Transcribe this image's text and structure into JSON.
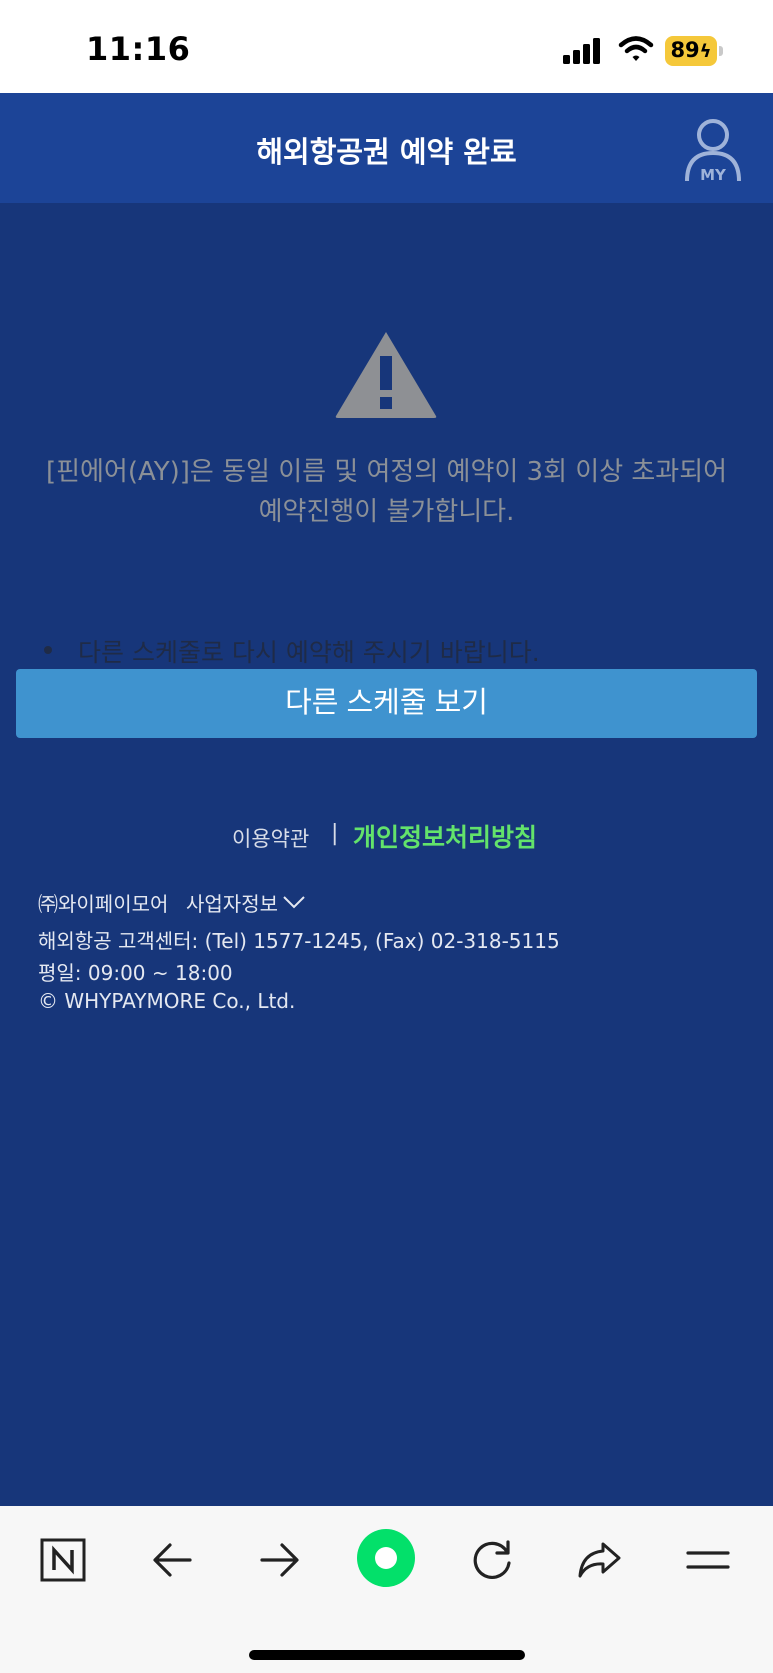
{
  "status_bar": {
    "time": "11:16",
    "battery": "89",
    "battery_color": "#f5c83a"
  },
  "header": {
    "title": "해외항공권 예약 완료",
    "my_label": "MY"
  },
  "message": {
    "text": "[핀에어(AY)]은 동일 이름 및 여정의 예약이 3회 이상 초과되어 예약진행이 불가합니다.",
    "hint": "다른 스케줄로 다시 예약해 주시기 바랍니다."
  },
  "actions": {
    "schedule_button": "다른 스케줄 보기"
  },
  "footer": {
    "terms": "이용약관",
    "divider": "|",
    "privacy": "개인정보처리방침",
    "company": "㈜와이페이모어",
    "biz_info": "사업자정보",
    "contact": "해외항공 고객센터: (Tel) 1577-1245, (Fax) 02-318-5115",
    "hours": "평일: 09:00 ~ 18:00",
    "copyright": "© WHYPAYMORE Co., Ltd."
  },
  "toolbar": {
    "items": [
      "naver-home-icon",
      "back-arrow-icon",
      "forward-arrow-icon",
      "green-dot-icon",
      "refresh-icon",
      "share-icon",
      "menu-icon"
    ]
  },
  "colors": {
    "header_bg": "#1c4497",
    "page_bg": "#17367a",
    "button_bg": "#3f93cf",
    "privacy_link": "#63e36b",
    "toolbar_accent": "#03e06a"
  }
}
